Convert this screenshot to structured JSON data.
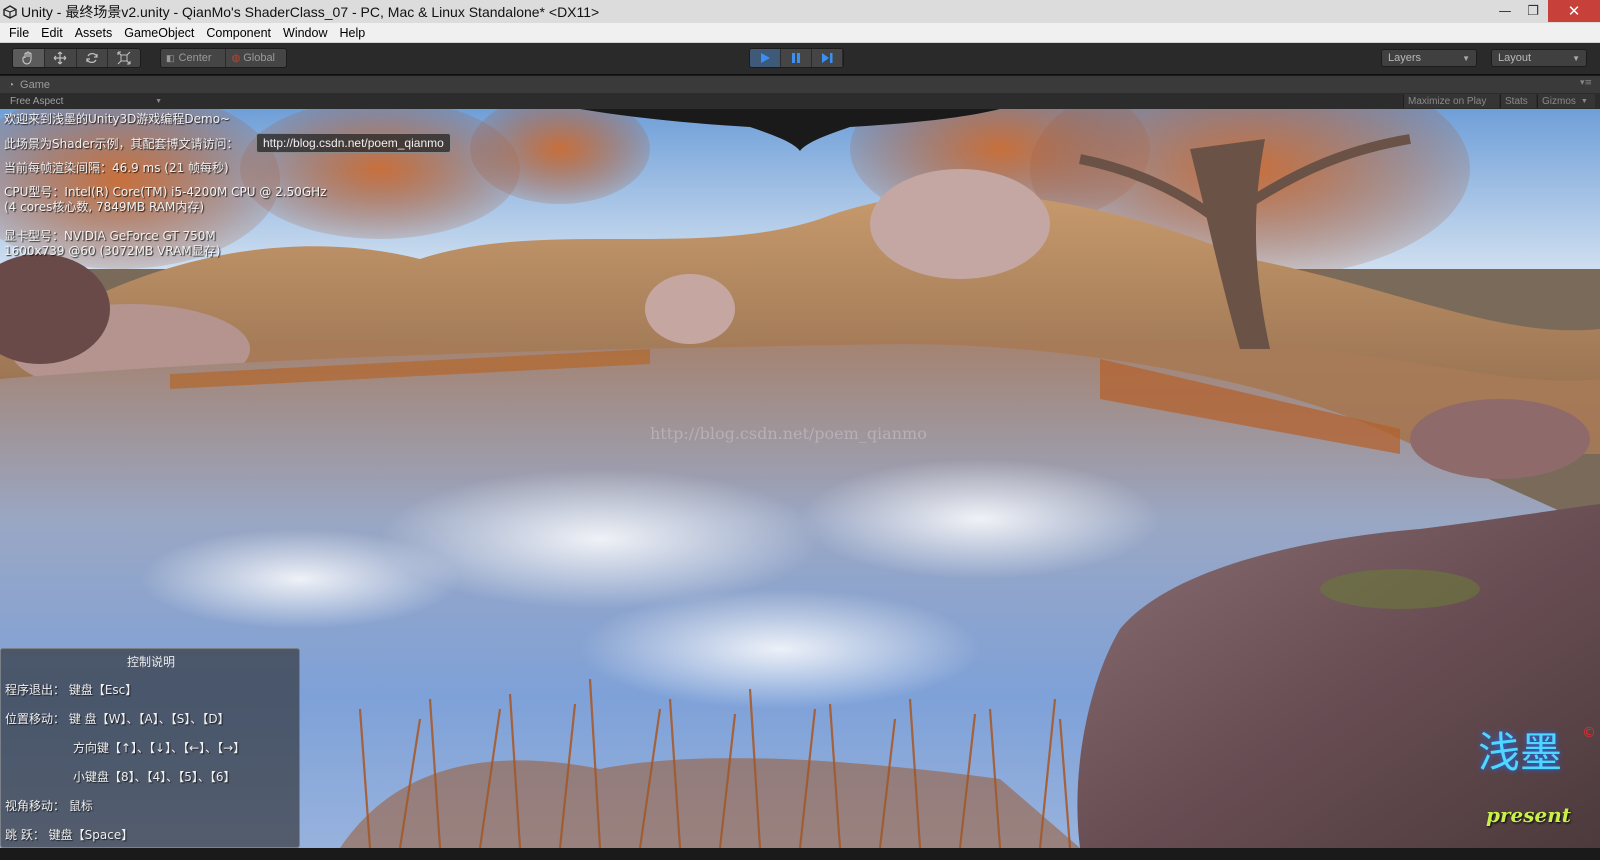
{
  "window": {
    "title": "Unity - 最终场景v2.unity - QianMo's ShaderClass_07 - PC, Mac & Linux Standalone* <DX11>",
    "minimize_glyph": "—",
    "maximize_glyph": "❐",
    "close_glyph": "✕"
  },
  "menu": [
    "File",
    "Edit",
    "Assets",
    "GameObject",
    "Component",
    "Window",
    "Help"
  ],
  "toolbar": {
    "transform_tools": [
      "hand-icon",
      "move-icon",
      "rotate-icon",
      "scale-icon"
    ],
    "pivot_label": "Center",
    "space_label": "Global",
    "play_controls": [
      "play-icon",
      "pause-icon",
      "step-icon"
    ],
    "layers_label": "Layers",
    "layout_label": "Layout"
  },
  "game_panel": {
    "tab_label": "Game",
    "aspect_label": "Free Aspect",
    "maximize_label": "Maximize on Play",
    "stats_label": "Stats",
    "gizmos_label": "Gizmos"
  },
  "overlay": {
    "welcome": "欢迎来到浅墨的Unity3D游戏编程Demo~",
    "scene_note": "此场景为Shader示例，其配套博文请访问：",
    "blog_link": "http://blog.csdn.net/poem_qianmo",
    "frame_time": "当前每帧渲染间隔：46.9 ms (21 帧每秒)",
    "cpu": "CPU型号：Intel(R) Core(TM) i5-4200M CPU @ 2.50GHz",
    "cpu_detail": "(4 cores核心数, 7849MB RAM内存)",
    "gpu": "显卡型号：NVIDIA GeForce GT 750M",
    "gpu_detail": "1600x739 @60 (3072MB VRAM显存)"
  },
  "help": {
    "title": "控制说明",
    "lines": [
      "程序退出：  键盘【Esc】",
      "位置移动：  键    盘【W】、【A】、【S】、【D】",
      "方向键【↑】、【↓】、【←】、【→】",
      "小键盘【8】、【4】、【5】、【6】",
      "视角移动：  鼠标",
      "跳      跃：  键盘【Space】"
    ]
  },
  "watermark": "http://blog.csdn.net/poem_qianmo",
  "logo": {
    "glyphs": "浅墨",
    "caption": "present"
  },
  "colors": {
    "play_active": "#3b8ff0",
    "close_button": "#c7403a",
    "logo_cyan": "#4fd8ff",
    "logo_green": "#c8f048"
  }
}
